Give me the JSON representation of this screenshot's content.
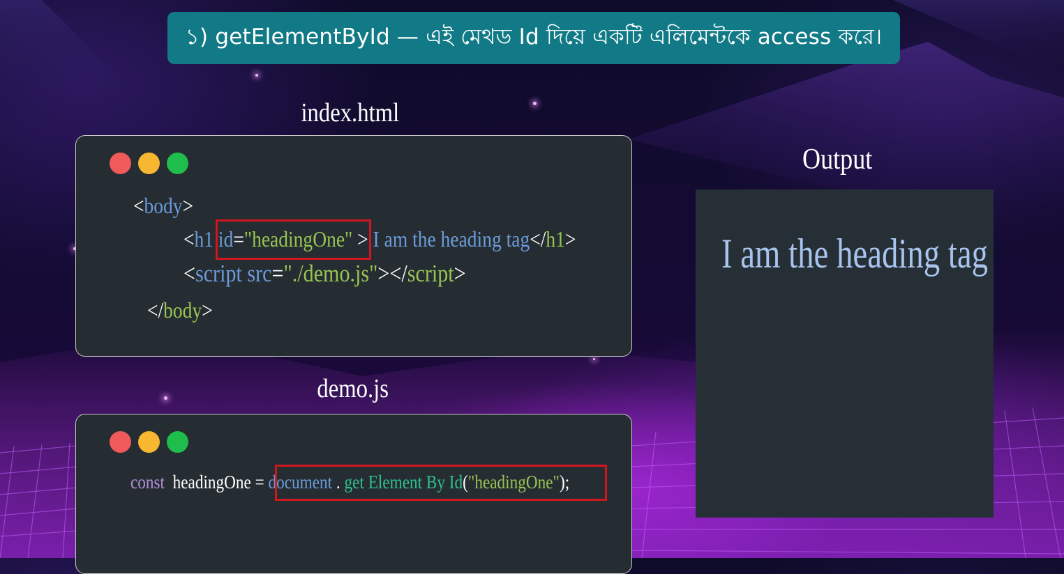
{
  "title": "১) getElementById — এই মেথড Id দিয়ে একটি এলিমেন্টকে access করে।",
  "index_file": {
    "label": "index.html",
    "lines": {
      "body_open": {
        "lt": "<",
        "tag": "body",
        "gt": ">"
      },
      "h1": {
        "lt": "<",
        "tag": "h1",
        "attr": "id",
        "eq": "=",
        "value": "\"headingOne\"",
        "gt": ">",
        "text": " I am the heading tag",
        "close_lt": "</",
        "close_tag": "h1",
        "close_gt": ">"
      },
      "script": {
        "lt": "<",
        "tag": "script",
        "attr": "src",
        "eq": "=",
        "value": "\"./demo.js\"",
        "gt": ">",
        "close_lt": "</",
        "close_tag": "script",
        "close_gt": ">"
      },
      "body_close": {
        "lt": "</",
        "tag": "body",
        "gt": ">"
      }
    }
  },
  "demo_file": {
    "label": "demo.js",
    "line": {
      "keyword": "const",
      "name": "headingOne",
      "eq": "=",
      "object": "document",
      "dot": ".",
      "method": "get Element By Id",
      "paren_open": "(",
      "arg": "\"headingOne\"",
      "paren_close": ");"
    }
  },
  "output": {
    "label": "Output",
    "heading": "I am the heading tag"
  },
  "colors": {
    "banner": "#127a86",
    "code_bg": "#252d33",
    "tag_blue": "#6b9bd8",
    "string_green": "#98c452",
    "keyword_purple": "#b48ed8",
    "method_green": "#2ec08a",
    "highlight_red": "#d1161e",
    "output_text": "#a8c4ec"
  }
}
